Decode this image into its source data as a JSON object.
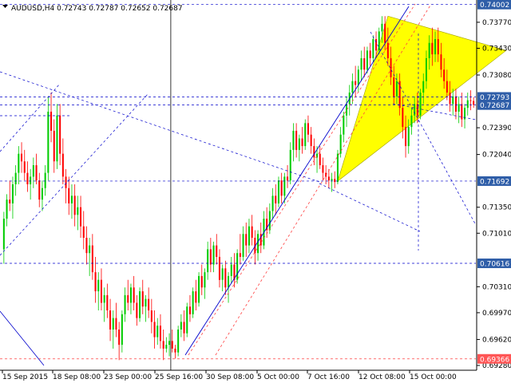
{
  "chart_data": {
    "type": "candlestick",
    "title": "AUDUSD,H4  0.72743 0.72787 0.72652 0.72687",
    "ylim": [
      0.6928,
      0.7403
    ],
    "y_ticks": [
      "0.73770",
      "0.73430",
      "0.73080",
      "0.72390",
      "0.72040",
      "0.71350",
      "0.71010",
      "0.70310",
      "0.69970",
      "0.69620",
      "0.69280"
    ],
    "y_tick_values": [
      0.7377,
      0.7343,
      0.7308,
      0.7239,
      0.7204,
      0.7135,
      0.7101,
      0.7031,
      0.6997,
      0.6962,
      0.6928
    ],
    "x_ticks": [
      "15 Sep 2015",
      "18 Sep 08:00",
      "23 Sep 00:00",
      "25 Sep 16:00",
      "30 Sep 08:00",
      "5 Oct 00:00",
      "7 Oct 16:00",
      "12 Oct 08:00",
      "15 Oct 00:00"
    ],
    "price_labels": [
      {
        "text": "0.74002",
        "value": 0.74002,
        "color": "#2f5ea8"
      },
      {
        "text": "0.72793",
        "value": 0.72793,
        "color": "#2f5ea8"
      },
      {
        "text": "0.72687",
        "value": 0.72687,
        "color": "#2f5ea8"
      },
      {
        "text": "0.71692",
        "value": 0.71692,
        "color": "#2f5ea8"
      },
      {
        "text": "0.70616",
        "value": 0.70616,
        "color": "#2f5ea8"
      },
      {
        "text": "0.69366",
        "value": 0.69366,
        "color": "#ff5555"
      }
    ],
    "hlines": [
      0.74002,
      0.72793,
      0.72687,
      0.71692,
      0.70616,
      0.69366
    ],
    "period_separator_index": 57,
    "triangle": [
      [
        113,
        0.71692
      ],
      [
        130,
        0.7385
      ],
      [
        170,
        0.734
      ]
    ],
    "candles": [
      [
        0.708,
        0.7129,
        0.7061,
        0.712
      ],
      [
        0.712,
        0.7152,
        0.711,
        0.7145
      ],
      [
        0.7145,
        0.717,
        0.713,
        0.714
      ],
      [
        0.714,
        0.7175,
        0.712,
        0.7165
      ],
      [
        0.7165,
        0.719,
        0.715,
        0.718
      ],
      [
        0.718,
        0.7215,
        0.7165,
        0.7205
      ],
      [
        0.7205,
        0.722,
        0.718,
        0.7195
      ],
      [
        0.7195,
        0.721,
        0.717,
        0.718
      ],
      [
        0.718,
        0.7195,
        0.7155,
        0.7165
      ],
      [
        0.7165,
        0.7185,
        0.7145,
        0.7175
      ],
      [
        0.7175,
        0.72,
        0.716,
        0.719
      ],
      [
        0.719,
        0.7205,
        0.7165,
        0.717
      ],
      [
        0.717,
        0.718,
        0.7135,
        0.7145
      ],
      [
        0.7145,
        0.717,
        0.713,
        0.716
      ],
      [
        0.716,
        0.719,
        0.715,
        0.718
      ],
      [
        0.718,
        0.728,
        0.717,
        0.726
      ],
      [
        0.726,
        0.7285,
        0.722,
        0.7235
      ],
      [
        0.7235,
        0.725,
        0.718,
        0.7195
      ],
      [
        0.7195,
        0.727,
        0.7185,
        0.7255
      ],
      [
        0.7255,
        0.727,
        0.719,
        0.7205
      ],
      [
        0.7205,
        0.7225,
        0.7165,
        0.7175
      ],
      [
        0.7175,
        0.7185,
        0.714,
        0.716
      ],
      [
        0.716,
        0.7175,
        0.7125,
        0.714
      ],
      [
        0.714,
        0.7165,
        0.712,
        0.715
      ],
      [
        0.715,
        0.7165,
        0.711,
        0.7125
      ],
      [
        0.7125,
        0.715,
        0.7105,
        0.7135
      ],
      [
        0.7135,
        0.715,
        0.7095,
        0.711
      ],
      [
        0.711,
        0.713,
        0.708,
        0.7095
      ],
      [
        0.7095,
        0.711,
        0.706,
        0.7075
      ],
      [
        0.7075,
        0.7095,
        0.7045,
        0.7085
      ],
      [
        0.7085,
        0.71,
        0.704,
        0.705
      ],
      [
        0.705,
        0.707,
        0.701,
        0.7025
      ],
      [
        0.7025,
        0.705,
        0.7,
        0.704
      ],
      [
        0.704,
        0.7055,
        0.7,
        0.701
      ],
      [
        0.701,
        0.703,
        0.6985,
        0.702
      ],
      [
        0.702,
        0.7035,
        0.699,
        0.7
      ],
      [
        0.7,
        0.7015,
        0.696,
        0.6975
      ],
      [
        0.6975,
        0.7,
        0.695,
        0.699
      ],
      [
        0.699,
        0.701,
        0.6965,
        0.6975
      ],
      [
        0.6975,
        0.6985,
        0.6935,
        0.6955
      ],
      [
        0.6955,
        0.7,
        0.6945,
        0.6995
      ],
      [
        0.6995,
        0.703,
        0.6985,
        0.702
      ],
      [
        0.702,
        0.704,
        0.7,
        0.701
      ],
      [
        0.701,
        0.7035,
        0.6995,
        0.703
      ],
      [
        0.703,
        0.7045,
        0.7,
        0.701
      ],
      [
        0.701,
        0.702,
        0.698,
        0.699
      ],
      [
        0.699,
        0.703,
        0.6985,
        0.7025
      ],
      [
        0.7025,
        0.704,
        0.6995,
        0.7005
      ],
      [
        0.7005,
        0.702,
        0.6985,
        0.7015
      ],
      [
        0.7015,
        0.703,
        0.699,
        0.7
      ],
      [
        0.7,
        0.7015,
        0.697,
        0.6985
      ],
      [
        0.6985,
        0.7,
        0.695,
        0.6965
      ],
      [
        0.6965,
        0.699,
        0.6955,
        0.698
      ],
      [
        0.698,
        0.6995,
        0.695,
        0.696
      ],
      [
        0.696,
        0.6975,
        0.6935,
        0.695
      ],
      [
        0.695,
        0.6965,
        0.6945,
        0.6955
      ],
      [
        0.6955,
        0.697,
        0.694,
        0.696
      ],
      [
        0.696,
        0.6975,
        0.6945,
        0.695
      ],
      [
        0.695,
        0.6955,
        0.6937,
        0.6945
      ],
      [
        0.6945,
        0.698,
        0.694,
        0.6975
      ],
      [
        0.6975,
        0.6995,
        0.6965,
        0.6985
      ],
      [
        0.6985,
        0.7,
        0.696,
        0.697
      ],
      [
        0.697,
        0.701,
        0.6965,
        0.7005
      ],
      [
        0.7005,
        0.702,
        0.6985,
        0.6995
      ],
      [
        0.6995,
        0.703,
        0.699,
        0.7025
      ],
      [
        0.7025,
        0.704,
        0.7,
        0.701
      ],
      [
        0.701,
        0.705,
        0.7005,
        0.7045
      ],
      [
        0.7045,
        0.706,
        0.702,
        0.703
      ],
      [
        0.703,
        0.7055,
        0.7015,
        0.705
      ],
      [
        0.705,
        0.709,
        0.704,
        0.708
      ],
      [
        0.708,
        0.7095,
        0.705,
        0.706
      ],
      [
        0.706,
        0.709,
        0.705,
        0.7085
      ],
      [
        0.7085,
        0.71,
        0.706,
        0.707
      ],
      [
        0.707,
        0.708,
        0.703,
        0.704
      ],
      [
        0.704,
        0.706,
        0.7025,
        0.7055
      ],
      [
        0.7055,
        0.7065,
        0.702,
        0.703
      ],
      [
        0.703,
        0.705,
        0.701,
        0.7045
      ],
      [
        0.7045,
        0.707,
        0.7035,
        0.706
      ],
      [
        0.706,
        0.7075,
        0.703,
        0.704
      ],
      [
        0.704,
        0.708,
        0.7035,
        0.7075
      ],
      [
        0.7075,
        0.71,
        0.706,
        0.707
      ],
      [
        0.707,
        0.711,
        0.7065,
        0.71
      ],
      [
        0.71,
        0.7115,
        0.707,
        0.7085
      ],
      [
        0.7085,
        0.712,
        0.7075,
        0.711
      ],
      [
        0.711,
        0.7125,
        0.7085,
        0.7095
      ],
      [
        0.7095,
        0.7105,
        0.706,
        0.7075
      ],
      [
        0.7075,
        0.7105,
        0.7065,
        0.71
      ],
      [
        0.71,
        0.7115,
        0.7075,
        0.7085
      ],
      [
        0.7085,
        0.713,
        0.708,
        0.712
      ],
      [
        0.712,
        0.7135,
        0.7095,
        0.7105
      ],
      [
        0.7105,
        0.714,
        0.71,
        0.713
      ],
      [
        0.713,
        0.716,
        0.712,
        0.715
      ],
      [
        0.715,
        0.7165,
        0.7125,
        0.714
      ],
      [
        0.714,
        0.7175,
        0.7135,
        0.717
      ],
      [
        0.717,
        0.718,
        0.714,
        0.715
      ],
      [
        0.715,
        0.718,
        0.714,
        0.7175
      ],
      [
        0.7175,
        0.719,
        0.716,
        0.717
      ],
      [
        0.717,
        0.722,
        0.7165,
        0.721
      ],
      [
        0.721,
        0.7245,
        0.7195,
        0.7235
      ],
      [
        0.7235,
        0.7245,
        0.72,
        0.721
      ],
      [
        0.721,
        0.723,
        0.7195,
        0.7225
      ],
      [
        0.7225,
        0.724,
        0.7205,
        0.7215
      ],
      [
        0.7215,
        0.725,
        0.721,
        0.7245
      ],
      [
        0.7245,
        0.7255,
        0.722,
        0.723
      ],
      [
        0.723,
        0.724,
        0.7205,
        0.7215
      ],
      [
        0.7215,
        0.7225,
        0.719,
        0.72
      ],
      [
        0.72,
        0.7215,
        0.718,
        0.7205
      ],
      [
        0.7205,
        0.7215,
        0.7185,
        0.719
      ],
      [
        0.719,
        0.72,
        0.717,
        0.718
      ],
      [
        0.718,
        0.719,
        0.7165,
        0.7175
      ],
      [
        0.7175,
        0.7185,
        0.716,
        0.717
      ],
      [
        0.717,
        0.718,
        0.7155,
        0.7172
      ],
      [
        0.7172,
        0.7182,
        0.716,
        0.7168
      ],
      [
        0.7168,
        0.721,
        0.7165,
        0.7205
      ],
      [
        0.7205,
        0.724,
        0.72,
        0.723
      ],
      [
        0.723,
        0.726,
        0.722,
        0.7255
      ],
      [
        0.7255,
        0.728,
        0.724,
        0.727
      ],
      [
        0.727,
        0.7295,
        0.7255,
        0.7285
      ],
      [
        0.7285,
        0.731,
        0.727,
        0.73
      ],
      [
        0.73,
        0.732,
        0.728,
        0.7295
      ],
      [
        0.7295,
        0.732,
        0.7285,
        0.7315
      ],
      [
        0.7315,
        0.734,
        0.73,
        0.733
      ],
      [
        0.733,
        0.7345,
        0.7305,
        0.7315
      ],
      [
        0.7315,
        0.7345,
        0.731,
        0.734
      ],
      [
        0.734,
        0.735,
        0.732,
        0.733
      ],
      [
        0.733,
        0.736,
        0.7325,
        0.7355
      ],
      [
        0.7355,
        0.7365,
        0.733,
        0.734
      ],
      [
        0.734,
        0.737,
        0.7335,
        0.7365
      ],
      [
        0.7365,
        0.7385,
        0.735,
        0.7375
      ],
      [
        0.7375,
        0.7385,
        0.734,
        0.735
      ],
      [
        0.735,
        0.737,
        0.732,
        0.733
      ],
      [
        0.733,
        0.7345,
        0.7295,
        0.7305
      ],
      [
        0.7305,
        0.732,
        0.727,
        0.728
      ],
      [
        0.728,
        0.731,
        0.727,
        0.73
      ],
      [
        0.73,
        0.731,
        0.7255,
        0.7265
      ],
      [
        0.7265,
        0.728,
        0.7225,
        0.724
      ],
      [
        0.724,
        0.7255,
        0.72,
        0.7215
      ],
      [
        0.7215,
        0.725,
        0.7205,
        0.724
      ],
      [
        0.724,
        0.7265,
        0.723,
        0.7255
      ],
      [
        0.7255,
        0.728,
        0.7245,
        0.727
      ],
      [
        0.727,
        0.7285,
        0.7245,
        0.7255
      ],
      [
        0.7255,
        0.729,
        0.725,
        0.7285
      ],
      [
        0.7285,
        0.731,
        0.727,
        0.73
      ],
      [
        0.73,
        0.734,
        0.729,
        0.733
      ],
      [
        0.733,
        0.736,
        0.7315,
        0.735
      ],
      [
        0.735,
        0.737,
        0.732,
        0.7335
      ],
      [
        0.7335,
        0.7365,
        0.7325,
        0.7355
      ],
      [
        0.7355,
        0.737,
        0.7325,
        0.7335
      ],
      [
        0.7335,
        0.735,
        0.7305,
        0.7315
      ],
      [
        0.7315,
        0.733,
        0.729,
        0.73
      ],
      [
        0.73,
        0.7315,
        0.7275,
        0.7285
      ],
      [
        0.7285,
        0.73,
        0.726,
        0.727
      ],
      [
        0.727,
        0.729,
        0.7255,
        0.728
      ],
      [
        0.728,
        0.729,
        0.725,
        0.726
      ],
      [
        0.726,
        0.728,
        0.7245,
        0.727
      ],
      [
        0.727,
        0.7285,
        0.724,
        0.725
      ],
      [
        0.725,
        0.727,
        0.7238,
        0.7265
      ],
      [
        0.7265,
        0.7285,
        0.7255,
        0.7275
      ],
      [
        0.7275,
        0.7288,
        0.7262,
        0.7274
      ],
      [
        0.7274,
        0.7279,
        0.7265,
        0.7269
      ]
    ]
  }
}
